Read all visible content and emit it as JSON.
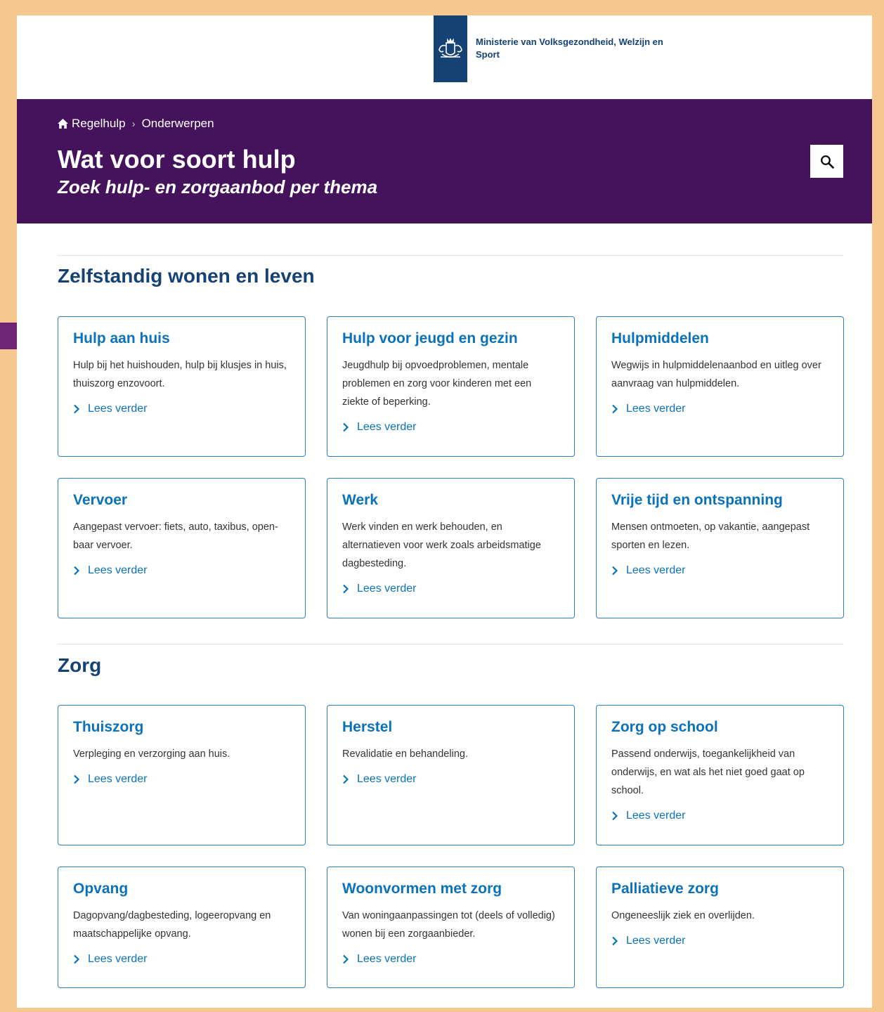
{
  "header": {
    "ministry_name": "Ministerie van Volksgezondheid, Welzijn en Sport",
    "logo_icon": "coat-of-arms-icon"
  },
  "banner": {
    "breadcrumb": [
      "Regelhulp",
      "Onderwerpen"
    ],
    "title": "Wat voor soort hulp",
    "subtitle": "Zoek hulp- en zorgaanbod per thema",
    "search_icon": "search-icon"
  },
  "sections": [
    {
      "title": "Zelfstandig wonen en leven",
      "cards": [
        {
          "title": "Hulp aan huis",
          "text": "Hulp bij het huishouden, hulp bij klusjes in huis, thuiszorg enzovoort.",
          "link": "Lees verder"
        },
        {
          "title": "Hulp voor jeugd en gezin",
          "text": "Jeugdhulp bij opvoedproblemen, mentale problemen en zorg voor kinderen met een ziekte of beperking.",
          "link": "Lees verder"
        },
        {
          "title": "Hulpmiddelen",
          "text": "Wegwijs in hulpmiddelenaanbod en uitleg over aanvraag van hulpmiddelen.",
          "link": "Lees verder"
        },
        {
          "title": "Vervoer",
          "text": "Aangepast vervoer: fiets, auto, taxibus, open­baar vervoer.",
          "link": "Lees verder"
        },
        {
          "title": "Werk",
          "text": "Werk vinden en werk behouden, en alternatieven voor werk zoals arbeidsmatige dagbesteding.",
          "link": "Lees verder"
        },
        {
          "title": "Vrije tijd en ontspanning",
          "text": "Mensen ontmoeten, op vakantie, aangepast sporten en lezen.",
          "link": "Lees verder"
        }
      ]
    },
    {
      "title": "Zorg",
      "cards": [
        {
          "title": "Thuiszorg",
          "text": "Verpleging en verzorging aan huis.",
          "link": "Lees verder"
        },
        {
          "title": "Herstel",
          "text": "Revalidatie en behandeling.",
          "link": "Lees verder"
        },
        {
          "title": "Zorg op school",
          "text": "Passend onderwijs, toegankelijkheid van onderwijs, en wat als het niet goed gaat op school.",
          "link": "Lees verder"
        },
        {
          "title": "Opvang",
          "text": "Dagopvang/dagbesteding, logeeropvang en maatschappelijke opvang.",
          "link": "Lees verder"
        },
        {
          "title": "Woonvormen met zorg",
          "text": "Van woningaanpassingen tot (deels of volle­dig) wonen bij een zorgaanbieder.",
          "link": "Lees verder"
        },
        {
          "title": "Palliatieve zorg",
          "text": "Ongeneeslijk ziek en overlijden.",
          "link": "Lees verder"
        }
      ]
    }
  ],
  "colors": {
    "banner": "#45135c",
    "heading": "#154273",
    "link": "#0b72b9",
    "card_border": "#2c7fb8",
    "frame_border": "#f6c890",
    "arrow": "#6e2576"
  }
}
